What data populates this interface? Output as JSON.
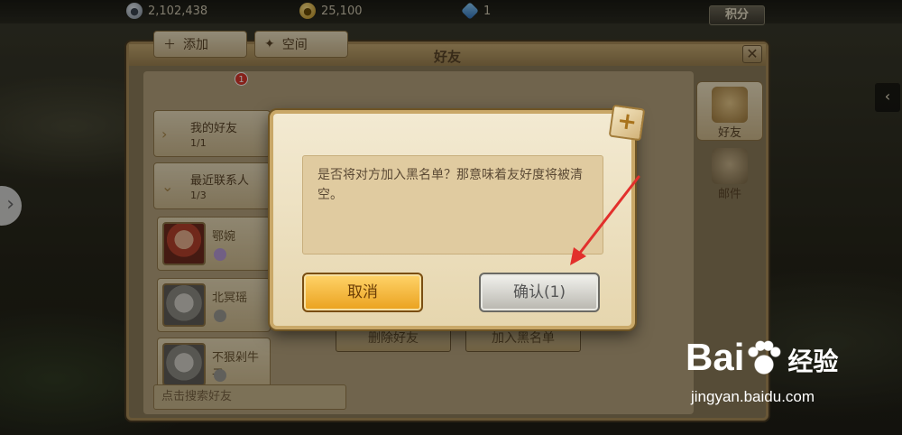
{
  "currencies": [
    {
      "icon": "silver-coin-icon",
      "value": "2,102,438"
    },
    {
      "icon": "gold-coin-icon",
      "value": "25,100"
    },
    {
      "icon": "gem-icon",
      "value": "1"
    }
  ],
  "topbar": {
    "points_label": "积分"
  },
  "panel": {
    "title": "好友",
    "close_glyph": "✕",
    "add_label": "添加",
    "add_badge": "1",
    "space_label": "空间",
    "groups": [
      {
        "name": "我的好友",
        "count": "1/1"
      },
      {
        "name": "最近联系人",
        "count": "1/3"
      }
    ],
    "friends": [
      {
        "name": "鄂婉"
      },
      {
        "name": "北冥瑶"
      },
      {
        "name": "不狠剁牛子"
      }
    ],
    "search_placeholder": "点击搜索好友",
    "side_tabs": [
      {
        "label": "好友",
        "icon": "friends-bag-icon"
      },
      {
        "label": "邮件",
        "icon": "mail-scroll-icon"
      }
    ],
    "action_delete": "删除好友",
    "action_blacklist": "加入黑名单"
  },
  "dialog": {
    "message": "是否将对方加入黑名单？那意味着友好度将被清空。",
    "cancel_label": "取消",
    "confirm_label": "确认(1)"
  },
  "watermark": {
    "brand_left": "Bai",
    "brand_right": "经验",
    "url": "jingyan.baidu.com"
  },
  "colors": {
    "accent_gold": "#eaa11e",
    "annotation_red": "#e2302c"
  }
}
